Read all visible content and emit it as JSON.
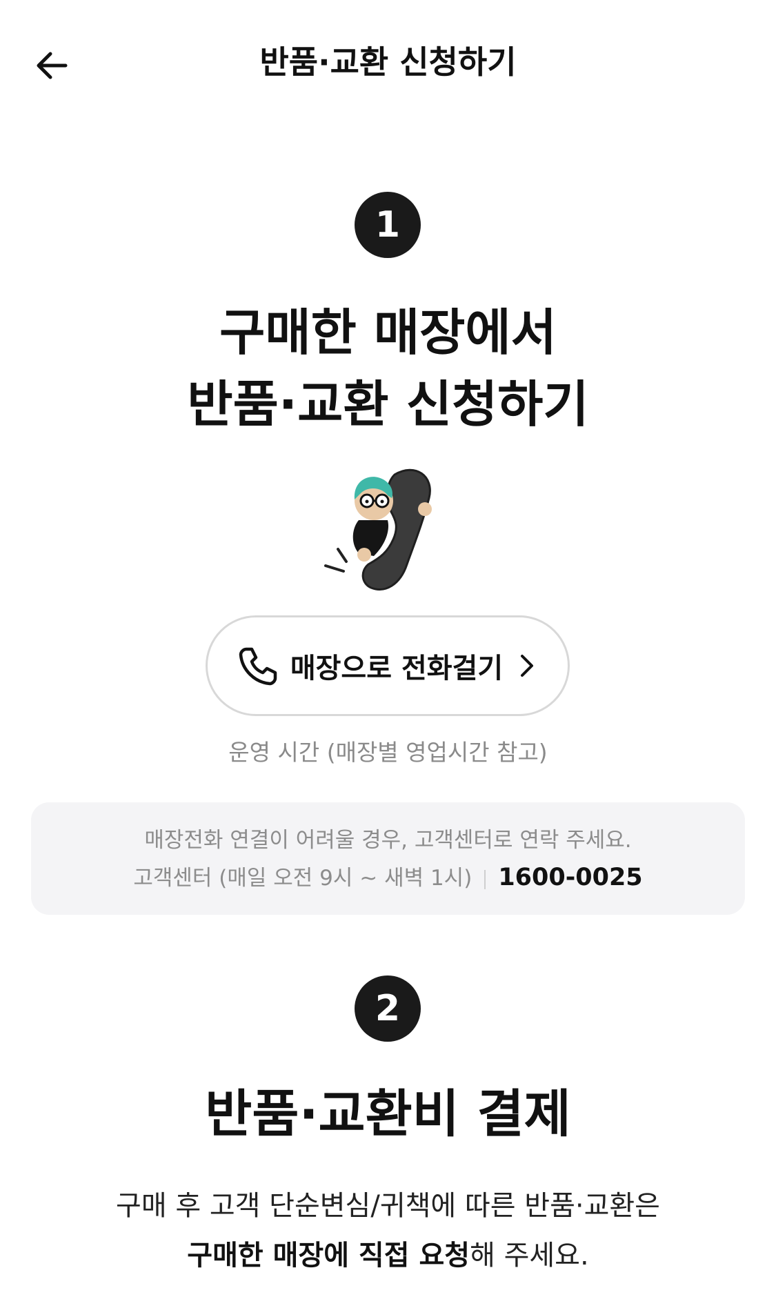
{
  "header": {
    "title": "반품·교환 신청하기",
    "back_icon": "arrow-left-icon"
  },
  "step1": {
    "number": "1",
    "title_line1": "구매한 매장에서",
    "title_line2": "반품·교환 신청하기",
    "illustration": "character-holding-phone-receiver",
    "call_button": {
      "icon": "phone-icon",
      "label": "매장으로 전화걸기",
      "chevron": "chevron-right-icon"
    },
    "hours_text": "운영 시간 (매장별 영업시간 참고)",
    "info": {
      "line1": "매장전화 연결이 어려울 경우, 고객센터로 연락 주세요.",
      "line2_label": "고객센터 (매일 오전 9시 ~ 새벽 1시)",
      "phone": "1600-0025"
    }
  },
  "step2": {
    "number": "2",
    "title": "반품·교환비 결제",
    "desc_line1": "구매 후 고객 단순변심/귀책에 따른 반품·교환은",
    "desc_line2_bold": "구매한 매장에 직접 요청",
    "desc_line2_rest": "해 주세요."
  }
}
